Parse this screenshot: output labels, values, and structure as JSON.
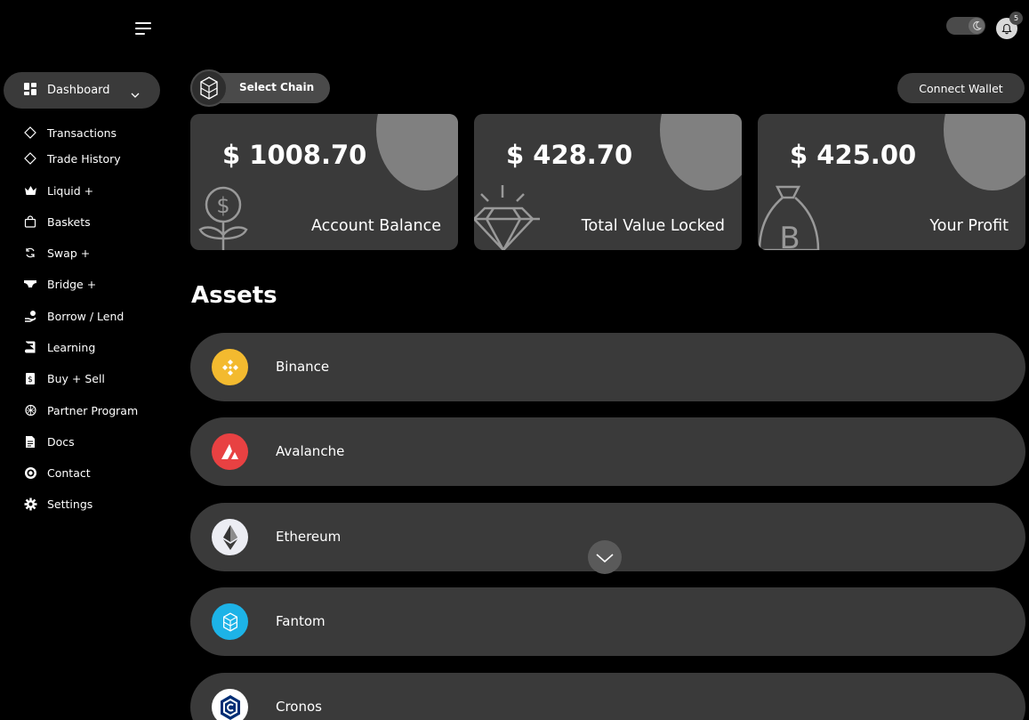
{
  "header": {
    "notification_count": "5"
  },
  "sidebar": {
    "dashboard_label": "Dashboard",
    "items": [
      {
        "label": "Transactions",
        "icon": "diamond-outline-icon"
      },
      {
        "label": "Trade History",
        "icon": "diamond-outline-icon"
      },
      {
        "label": "Liquid +",
        "icon": "crown-icon"
      },
      {
        "label": "Baskets",
        "icon": "shopping-bag-icon"
      },
      {
        "label": "Swap +",
        "icon": "swap-icon"
      },
      {
        "label": "Bridge +",
        "icon": "bridge-icon"
      },
      {
        "label": "Borrow / Lend",
        "icon": "hand-coin-icon"
      },
      {
        "label": "Learning",
        "icon": "book-icon"
      },
      {
        "label": "Buy + Sell",
        "icon": "receipt-icon"
      },
      {
        "label": "Partner Program",
        "icon": "partner-icon"
      },
      {
        "label": "Docs",
        "icon": "document-icon"
      },
      {
        "label": "Contact",
        "icon": "contact-icon"
      },
      {
        "label": "Settings",
        "icon": "gear-icon"
      }
    ]
  },
  "toolbar": {
    "select_chain_label": "Select Chain",
    "connect_wallet_label": "Connect Wallet"
  },
  "stats": [
    {
      "value": "$ 1008.70",
      "label": "Account Balance",
      "icon": "money-plant-icon"
    },
    {
      "value": "$ 428.70",
      "label": "Total Value Locked",
      "icon": "gem-icon"
    },
    {
      "value": "$ 425.00",
      "label": "Your Profit",
      "icon": "bitcoin-bag-icon"
    }
  ],
  "assets": {
    "title": "Assets",
    "items": [
      {
        "name": "Binance",
        "color": "#f3ba2f",
        "icon": "binance-icon"
      },
      {
        "name": "Avalanche",
        "color": "#e84142",
        "icon": "avalanche-icon"
      },
      {
        "name": "Ethereum",
        "color": "#ecedf3",
        "icon": "ethereum-icon"
      },
      {
        "name": "Fantom",
        "color": "#1db3e7",
        "icon": "fantom-icon"
      },
      {
        "name": "Cronos",
        "color": "#ffffff",
        "icon": "cronos-icon"
      }
    ]
  },
  "colors": {
    "background": "#000000",
    "card": "#3a3a3a",
    "accent_circle": "#808080"
  }
}
